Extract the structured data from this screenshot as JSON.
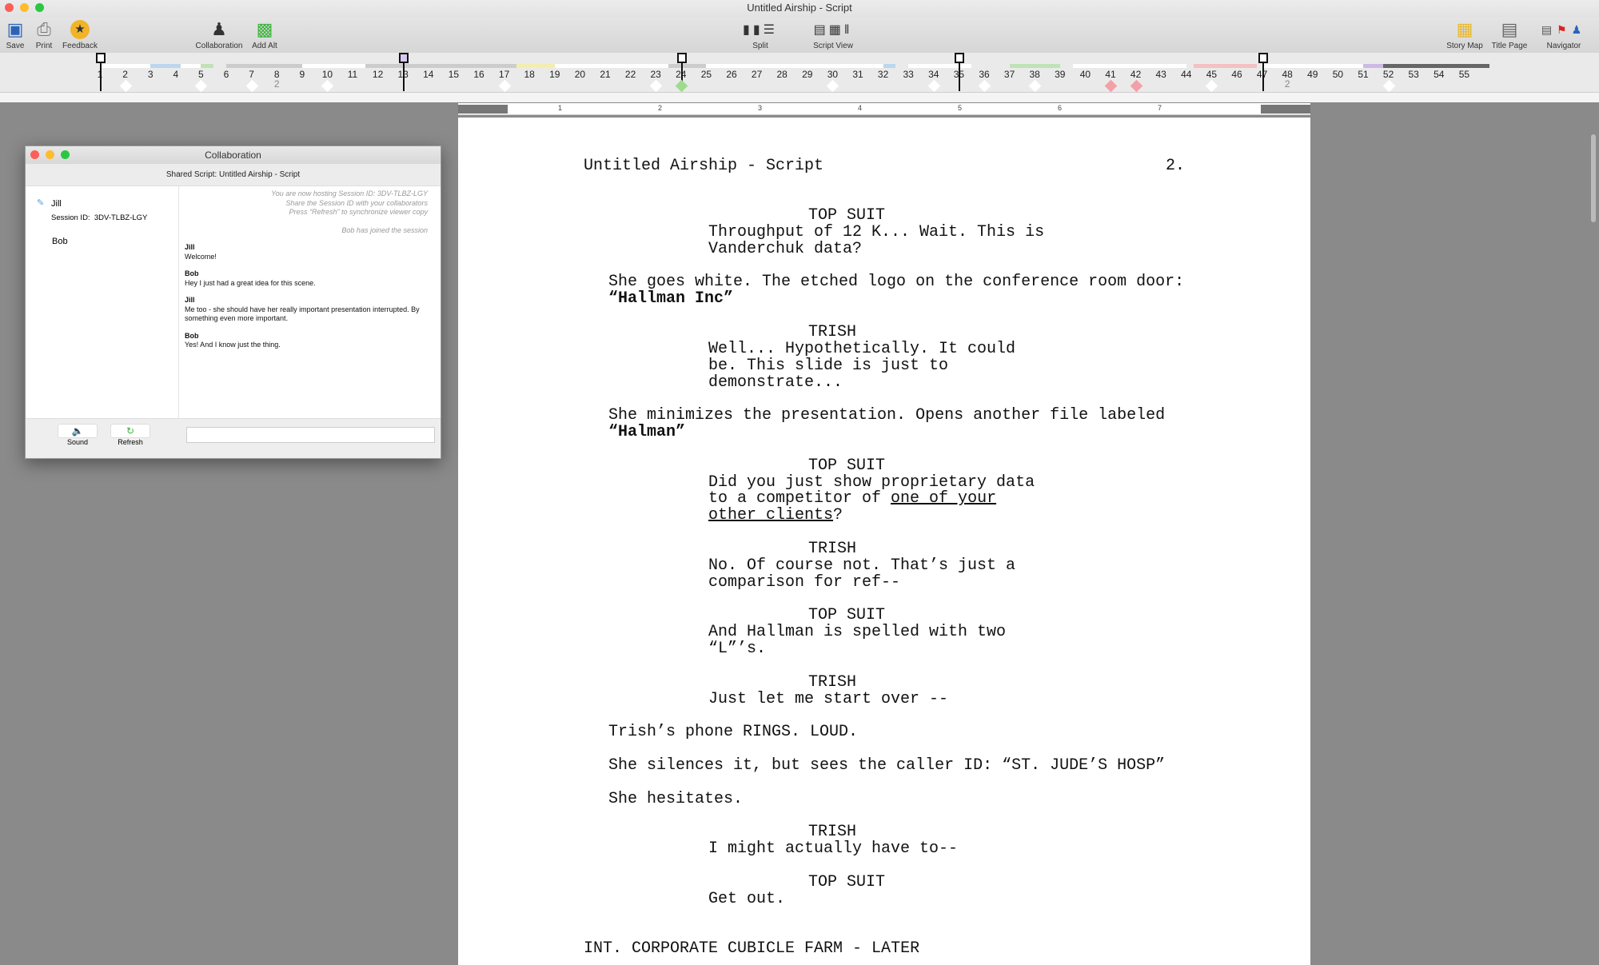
{
  "window": {
    "title": "Untitled Airship - Script"
  },
  "toolbar": {
    "save": "Save",
    "print": "Print",
    "feedback": "Feedback",
    "collaboration": "Collaboration",
    "add_alt": "Add Alt",
    "split": "Split",
    "script_view": "Script View",
    "story_map": "Story Map",
    "title_page": "Title Page",
    "navigator": "Navigator"
  },
  "timeline": {
    "numbers": [
      1,
      2,
      3,
      4,
      5,
      6,
      7,
      8,
      9,
      10,
      11,
      12,
      13,
      14,
      15,
      16,
      17,
      18,
      19,
      20,
      21,
      22,
      23,
      24,
      25,
      26,
      27,
      28,
      29,
      30,
      31,
      32,
      33,
      34,
      35,
      36,
      37,
      38,
      39,
      40,
      41,
      42,
      43,
      44,
      45,
      46,
      47,
      48,
      49,
      50,
      51,
      52,
      53,
      54,
      55
    ],
    "page_markers": [
      1,
      13,
      24,
      35,
      47
    ],
    "badge_8": "2",
    "badge_48": "2"
  },
  "ruler": {
    "labels": [
      "1",
      "2",
      "3",
      "4",
      "5",
      "6",
      "7"
    ]
  },
  "script": {
    "header": "Untitled Airship - Script",
    "page_number": "2.",
    "lines": [
      {
        "t": "character",
        "text": "TOP SUIT"
      },
      {
        "t": "dialogue",
        "text": "Throughput of 12 K... Wait. This is"
      },
      {
        "t": "dialogue",
        "text": "Vanderchuk data?"
      },
      {
        "t": "blank",
        "text": ""
      },
      {
        "t": "action",
        "text": "She goes white. The etched logo on the conference room door:"
      },
      {
        "t": "action-bold",
        "text": "“Hallman Inc”"
      },
      {
        "t": "blank",
        "text": ""
      },
      {
        "t": "character",
        "text": "TRISH"
      },
      {
        "t": "dialogue",
        "text": "Well... Hypothetically. It could"
      },
      {
        "t": "dialogue",
        "text": "be. This slide is just to"
      },
      {
        "t": "dialogue",
        "text": "demonstrate..."
      },
      {
        "t": "blank",
        "text": ""
      },
      {
        "t": "action",
        "text": "She minimizes the presentation. Opens another file labeled"
      },
      {
        "t": "action-bold",
        "text": "“Halman”"
      },
      {
        "t": "blank",
        "text": ""
      },
      {
        "t": "character",
        "text": "TOP SUIT"
      },
      {
        "t": "dialogue",
        "text": "Did you just show proprietary data"
      },
      {
        "t": "dialogue-u1",
        "text": "to a competitor of ",
        "u": "one of your"
      },
      {
        "t": "dialogue-u2",
        "text": "?",
        "u": "other clients"
      },
      {
        "t": "blank",
        "text": ""
      },
      {
        "t": "character",
        "text": "TRISH"
      },
      {
        "t": "dialogue",
        "text": "No. Of course not. That’s just a"
      },
      {
        "t": "dialogue",
        "text": "comparison for ref--"
      },
      {
        "t": "blank",
        "text": ""
      },
      {
        "t": "character",
        "text": "TOP SUIT"
      },
      {
        "t": "dialogue",
        "text": "And Hallman is spelled with two"
      },
      {
        "t": "dialogue",
        "text": "“L”’s."
      },
      {
        "t": "blank",
        "text": ""
      },
      {
        "t": "character",
        "text": "TRISH"
      },
      {
        "t": "dialogue",
        "text": "Just let me start over --"
      },
      {
        "t": "blank",
        "text": ""
      },
      {
        "t": "action",
        "text": "Trish’s phone RINGS. LOUD."
      },
      {
        "t": "blank",
        "text": ""
      },
      {
        "t": "action",
        "text": "She silences it, but sees the caller ID: “ST. JUDE’S HOSP”"
      },
      {
        "t": "blank",
        "text": ""
      },
      {
        "t": "action",
        "text": "She hesitates."
      },
      {
        "t": "blank",
        "text": ""
      },
      {
        "t": "character",
        "text": "TRISH"
      },
      {
        "t": "dialogue",
        "text": "I might actually have to--"
      },
      {
        "t": "blank",
        "text": ""
      },
      {
        "t": "character",
        "text": "TOP SUIT"
      },
      {
        "t": "dialogue",
        "text": "Get out."
      },
      {
        "t": "blank",
        "text": ""
      },
      {
        "t": "blank",
        "text": ""
      },
      {
        "t": "heading",
        "text": "INT. CORPORATE CUBICLE FARM - LATER"
      }
    ]
  },
  "collab": {
    "title": "Collaboration",
    "subtitle": "Shared Script: Untitled Airship - Script",
    "host": "Jill",
    "session_label": "Session ID:",
    "session_id": "3DV-TLBZ-LGY",
    "guest": "Bob",
    "system": [
      "You are now hosting Session ID: 3DV-TLBZ-LGY",
      "Share the Session ID with your collaborators",
      "Press “Refresh” to synchronize viewer copy"
    ],
    "joined": "Bob has joined the session",
    "messages": [
      {
        "from": "Jill",
        "text": "Welcome!"
      },
      {
        "from": "Bob",
        "text": "Hey I just had a great idea for this scene."
      },
      {
        "from": "Jill",
        "text": "Me too - she should have her really important presentation interrupted. By something even more important."
      },
      {
        "from": "Bob",
        "text": "Yes! And I know just the thing."
      }
    ],
    "sound": "Sound",
    "refresh": "Refresh",
    "input_value": ""
  },
  "colors": {
    "blue": "#bcd6ee",
    "green": "#bfe3b6",
    "yellow": "#f3eeae",
    "pink": "#f3c0c4",
    "purple": "#cdb9e6",
    "dark": "#666666",
    "gray": "#cccccc"
  }
}
